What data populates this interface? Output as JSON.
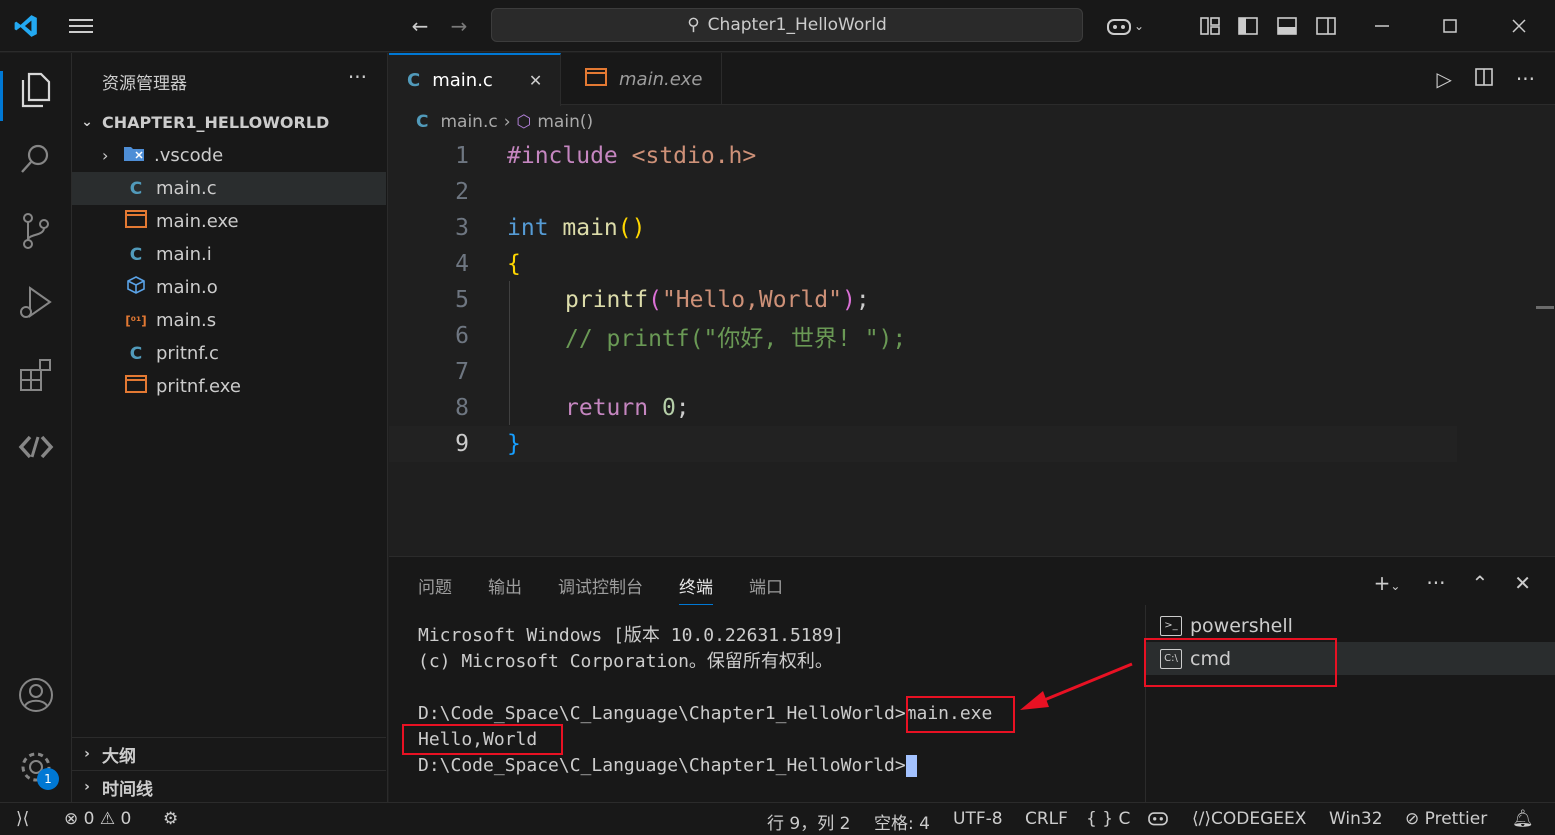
{
  "titlebar": {
    "search_text": "Chapter1_HelloWorld"
  },
  "sidebar": {
    "title": "资源管理器",
    "more": "···",
    "section": "CHAPTER1_HELLOWORLD",
    "items": [
      {
        "label": ".vscode",
        "icon": "folder-icon",
        "chev": "›"
      },
      {
        "label": "main.c",
        "icon": "c-file-icon"
      },
      {
        "label": "main.exe",
        "icon": "exe-file-icon"
      },
      {
        "label": "main.i",
        "icon": "c-file-icon"
      },
      {
        "label": "main.o",
        "icon": "object-file-icon"
      },
      {
        "label": "main.s",
        "icon": "asm-file-icon"
      },
      {
        "label": "pritnf.c",
        "icon": "c-file-icon"
      },
      {
        "label": "pritnf.exe",
        "icon": "exe-file-icon"
      }
    ],
    "outline": "大纲",
    "timeline": "时间线"
  },
  "editor": {
    "tabs": [
      {
        "label": "main.c",
        "active": true
      },
      {
        "label": "main.exe",
        "active": false
      }
    ],
    "breadcrumb": {
      "file": "main.c",
      "symbol": "main()"
    },
    "line_numbers": [
      "1",
      "2",
      "3",
      "4",
      "5",
      "6",
      "7",
      "8",
      "9"
    ],
    "code": {
      "l1_inc": "#include",
      "l1_hdr": " <stdio.h>",
      "l3_type": "int",
      "l3_fn": " main",
      "l3_parens": "()",
      "l4": "{",
      "l5_fn": "printf",
      "l5_open": "(",
      "l5_str": "\"Hello,World\"",
      "l5_close": ")",
      "l5_semi": ";",
      "l6": "// printf(\"你好, 世界! \");",
      "l8_kw": "return",
      "l8_num": " 0",
      "l8_semi": ";",
      "l9": "}"
    }
  },
  "panel": {
    "tabs": [
      "问题",
      "输出",
      "调试控制台",
      "终端",
      "端口"
    ],
    "active_tab": "终端",
    "terminal_lines": [
      "Microsoft Windows [版本 10.0.22631.5189]",
      "(c) Microsoft Corporation。保留所有权利。",
      "",
      "D:\\Code_Space\\C_Language\\Chapter1_HelloWorld>main.exe",
      "Hello,World",
      "D:\\Code_Space\\C_Language\\Chapter1_HelloWorld>"
    ],
    "terminals": [
      {
        "label": "powershell"
      },
      {
        "label": "cmd"
      }
    ]
  },
  "statusbar": {
    "errors": "0",
    "warnings": "0",
    "position": "行 9，列 2",
    "spaces": "空格: 4",
    "encoding": "UTF-8",
    "eol": "CRLF",
    "language": "C",
    "codegeex": "CODEGEEX",
    "platform": "Win32",
    "prettier": "Prettier"
  },
  "activity": {
    "badge": "1"
  },
  "colors": {
    "accent": "#0078d4",
    "annotation": "#e81123",
    "background": "#1f1f1f"
  }
}
